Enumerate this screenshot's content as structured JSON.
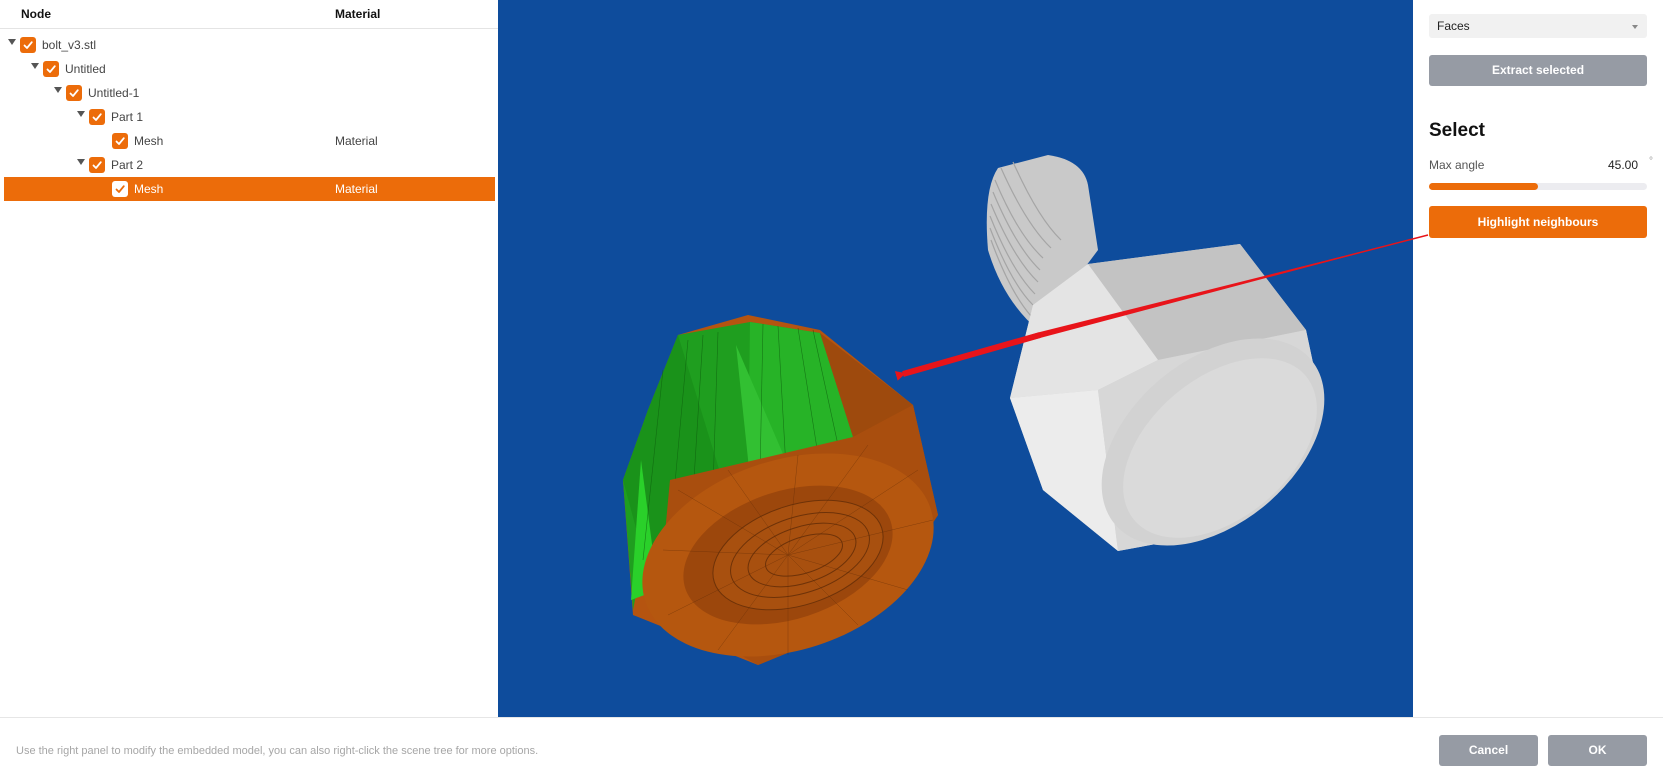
{
  "tree": {
    "columns": {
      "node": "Node",
      "material": "Material"
    },
    "rows": [
      {
        "label": "bolt_v3.stl",
        "material": "",
        "level": 0,
        "expanded": true,
        "checked": true,
        "selected": false
      },
      {
        "label": "Untitled",
        "material": "",
        "level": 1,
        "expanded": true,
        "checked": true,
        "selected": false
      },
      {
        "label": "Untitled-1",
        "material": "",
        "level": 2,
        "expanded": true,
        "checked": true,
        "selected": false
      },
      {
        "label": "Part 1",
        "material": "",
        "level": 3,
        "expanded": true,
        "checked": true,
        "selected": false
      },
      {
        "label": "Mesh",
        "material": "Material",
        "level": 4,
        "expanded": false,
        "checked": true,
        "selected": false
      },
      {
        "label": "Part 2",
        "material": "",
        "level": 3,
        "expanded": true,
        "checked": true,
        "selected": false
      },
      {
        "label": "Mesh",
        "material": "Material",
        "level": 4,
        "expanded": false,
        "checked": true,
        "selected": true
      }
    ]
  },
  "right_panel": {
    "mode_select": {
      "value": "Faces"
    },
    "extract_label": "Extract selected",
    "select_heading": "Select",
    "max_angle": {
      "label": "Max angle",
      "value": "45.00",
      "unit": "°",
      "fraction": 0.5
    },
    "highlight_label": "Highlight neighbours"
  },
  "footer": {
    "hint": "Use the right panel to modify the embedded model, you can also right-click the scene tree for more options.",
    "cancel_label": "Cancel",
    "ok_label": "OK"
  },
  "colors": {
    "accent": "#ec6c0a",
    "viewport_bg": "#0e4c9c",
    "button_gray": "#969ba4",
    "selected_faces": "#22b022",
    "nut_faces": "#b8560f",
    "bolt": "#d6d6d6",
    "annotation_arrow": "#e8141a"
  }
}
